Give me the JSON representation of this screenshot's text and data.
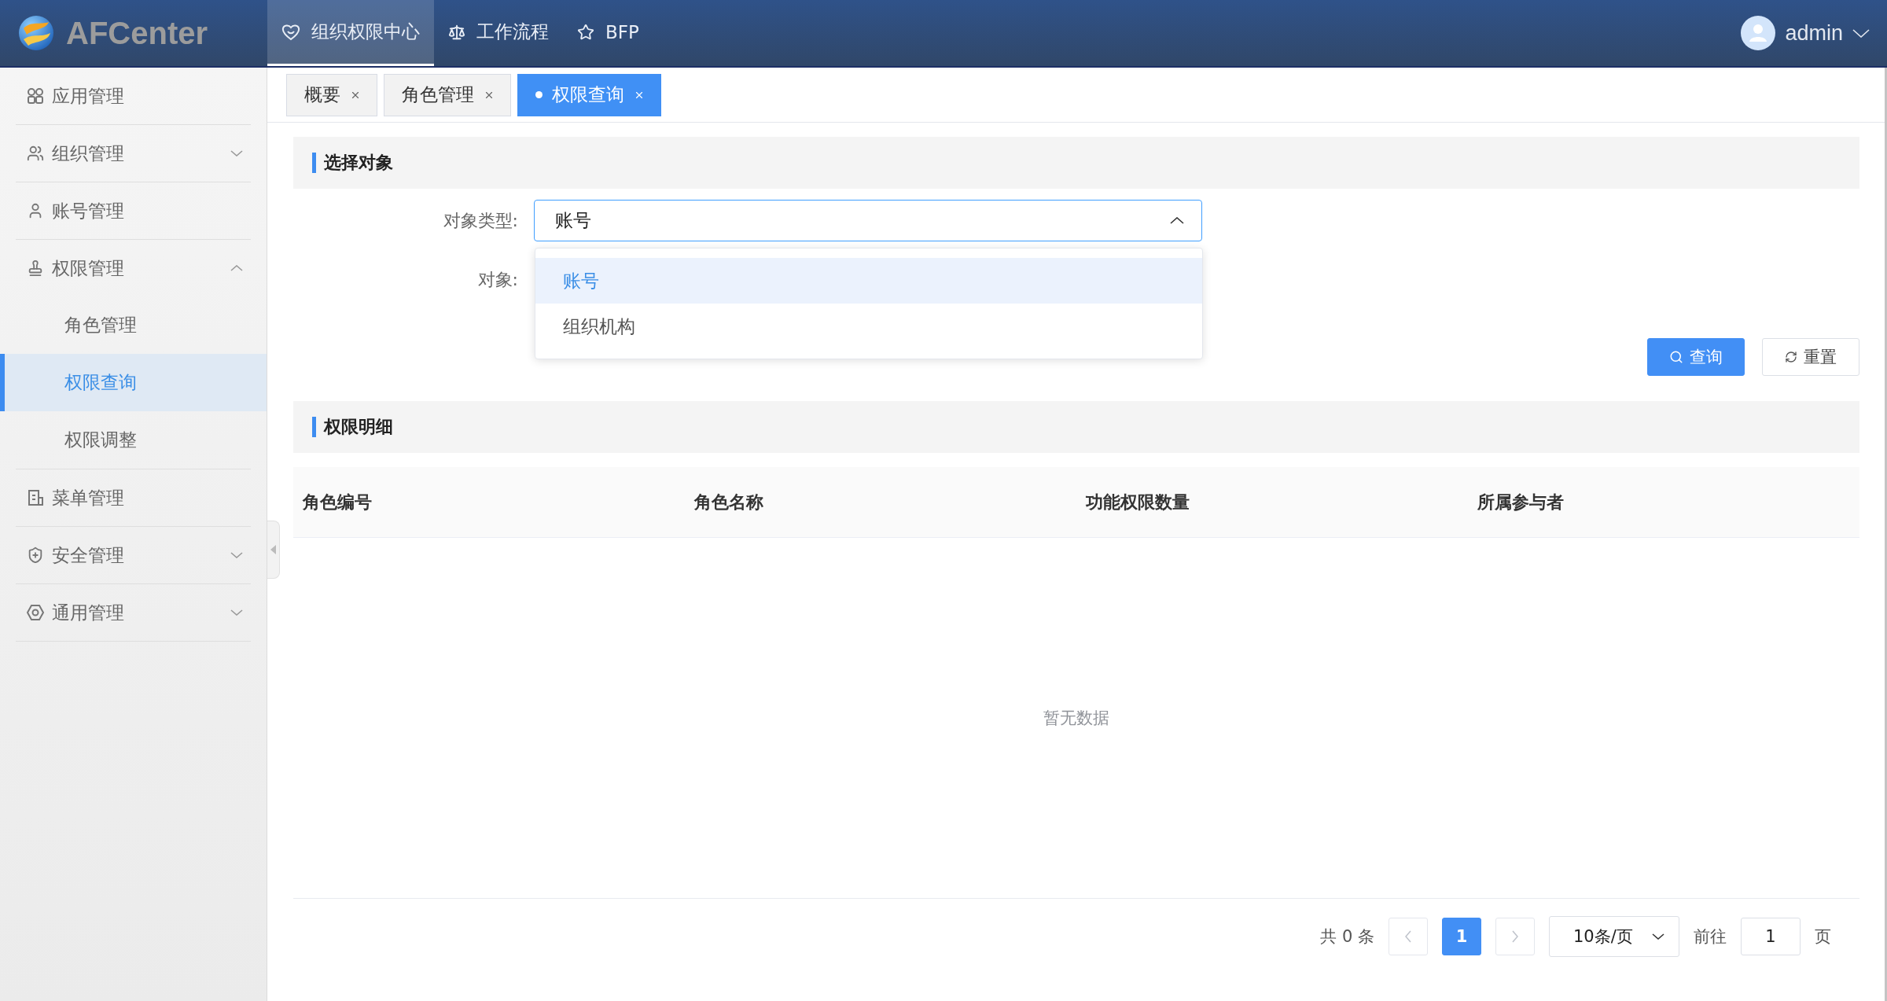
{
  "header": {
    "logo": "AFCenter",
    "nav": [
      {
        "label": "组织权限中心",
        "selected": true
      },
      {
        "label": "工作流程",
        "selected": false
      },
      {
        "label": "BFP",
        "selected": false
      }
    ],
    "user": "admin"
  },
  "sidebar": {
    "items": [
      {
        "label": "应用管理"
      },
      {
        "label": "组织管理",
        "expanded": false
      },
      {
        "label": "账号管理"
      },
      {
        "label": "权限管理",
        "expanded": true,
        "children": [
          {
            "label": "角色管理",
            "selected": false
          },
          {
            "label": "权限查询",
            "selected": true
          },
          {
            "label": "权限调整",
            "selected": false
          }
        ]
      },
      {
        "label": "菜单管理"
      },
      {
        "label": "安全管理",
        "expanded": false
      },
      {
        "label": "通用管理",
        "expanded": false
      }
    ]
  },
  "tabs": [
    {
      "label": "概要",
      "selected": false
    },
    {
      "label": "角色管理",
      "selected": false
    },
    {
      "label": "权限查询",
      "selected": true
    }
  ],
  "filter": {
    "title": "选择对象",
    "fields": [
      {
        "label": "对象类型:",
        "value": "账号",
        "open": true,
        "options": [
          {
            "label": "账号",
            "selected": true
          },
          {
            "label": "组织机构",
            "selected": false
          }
        ]
      },
      {
        "label": "对象:"
      }
    ],
    "buttons": [
      {
        "label": "查询",
        "kind": "primary"
      },
      {
        "label": "重置",
        "kind": "default"
      }
    ]
  },
  "table": {
    "title": "权限明细",
    "columns": [
      "角色编号",
      "角色名称",
      "功能权限数量",
      "所属参与者"
    ],
    "empty_text": "暂无数据"
  },
  "pagination": {
    "total": "共 0 条",
    "pages": [
      {
        "label": "1",
        "selected": true
      }
    ],
    "page_size": "10条/页",
    "goto_label": "前往",
    "goto_value": "1",
    "page_unit": "页"
  }
}
